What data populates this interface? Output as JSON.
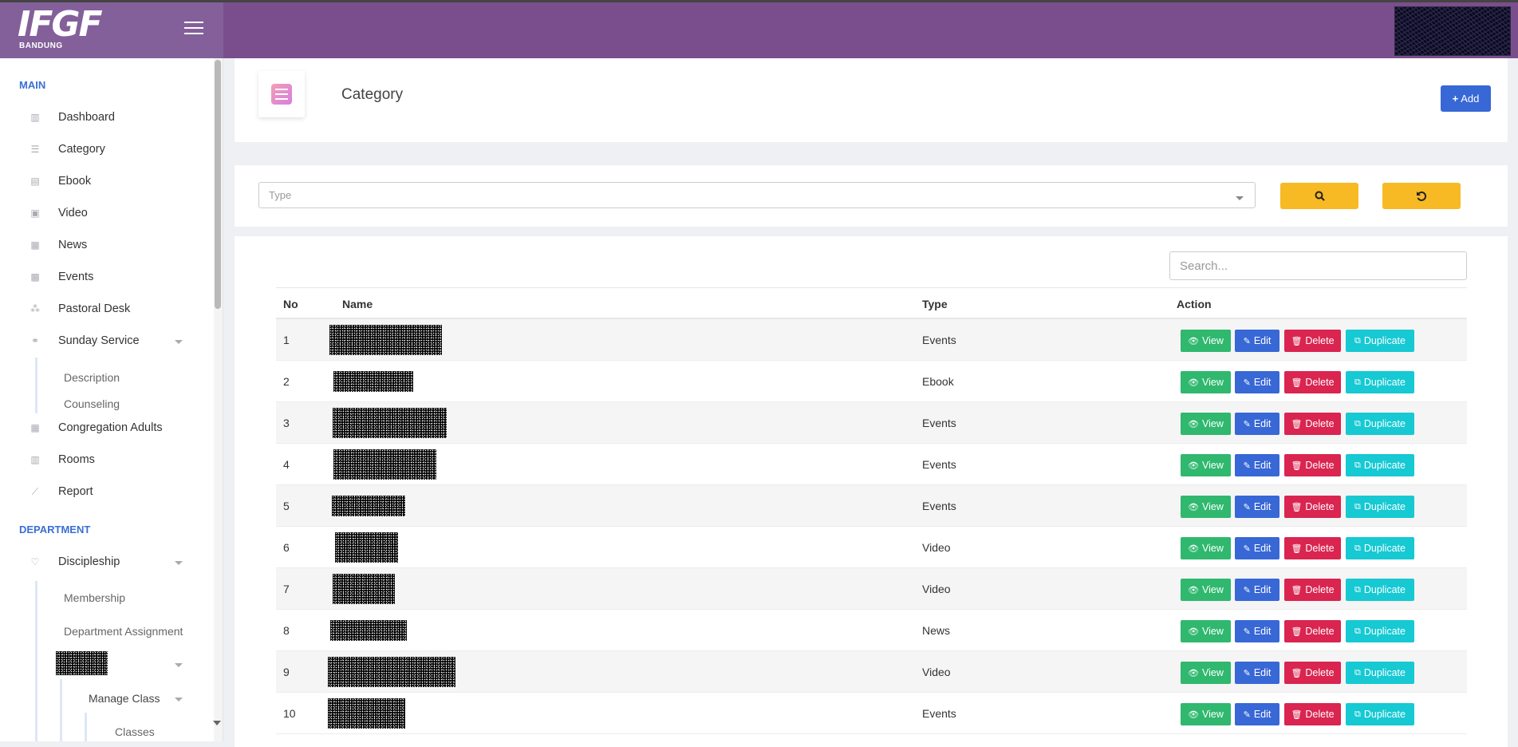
{
  "brand": {
    "logo": "IFGF",
    "sub": "BANDUNG"
  },
  "sidebar": {
    "main_label": "MAIN",
    "items": [
      {
        "label": "Dashboard",
        "icon": "bar-chart-icon"
      },
      {
        "label": "Category",
        "icon": "list-icon"
      },
      {
        "label": "Ebook",
        "icon": "file-icon"
      },
      {
        "label": "Video",
        "icon": "file-video-icon"
      },
      {
        "label": "News",
        "icon": "newspaper-icon"
      },
      {
        "label": "Events",
        "icon": "calendar-icon"
      },
      {
        "label": "Pastoral Desk",
        "icon": "sitemap-icon"
      },
      {
        "label": "Sunday Service",
        "icon": "handshake-icon"
      }
    ],
    "sunday_sub": [
      "Description",
      "Counseling"
    ],
    "items2": [
      {
        "label": "Congregation Adults",
        "icon": "calculator-icon"
      },
      {
        "label": "Rooms",
        "icon": "building-icon"
      },
      {
        "label": "Report",
        "icon": "line-chart-icon"
      }
    ],
    "dept_label": "DEPARTMENT",
    "discipleship": {
      "label": "Discipleship",
      "icon": "heart-icon"
    },
    "discipleship_sub": [
      "Membership",
      "Department Assignment"
    ],
    "manage_class": "Manage Class",
    "classes": "Classes"
  },
  "header": {
    "title": "Category",
    "add_label": "Add"
  },
  "filter": {
    "type_placeholder": "Type"
  },
  "table": {
    "search_placeholder": "Search...",
    "columns": [
      "No",
      "Name",
      "Type",
      "Action"
    ],
    "action_labels": {
      "view": "View",
      "edit": "Edit",
      "delete": "Delete",
      "duplicate": "Duplicate"
    },
    "rows": [
      {
        "no": "1",
        "type": "Events"
      },
      {
        "no": "2",
        "type": "Ebook"
      },
      {
        "no": "3",
        "type": "Events"
      },
      {
        "no": "4",
        "type": "Events"
      },
      {
        "no": "5",
        "type": "Events"
      },
      {
        "no": "6",
        "type": "Video"
      },
      {
        "no": "7",
        "type": "Video"
      },
      {
        "no": "8",
        "type": "News"
      },
      {
        "no": "9",
        "type": "Video"
      },
      {
        "no": "10",
        "type": "Events"
      }
    ]
  },
  "colors": {
    "topbar": "#7a4e8c",
    "primary": "#3867d6",
    "success": "#2fb86e",
    "danger": "#d92550",
    "info": "#16c9d3",
    "warning": "#f7b924"
  }
}
